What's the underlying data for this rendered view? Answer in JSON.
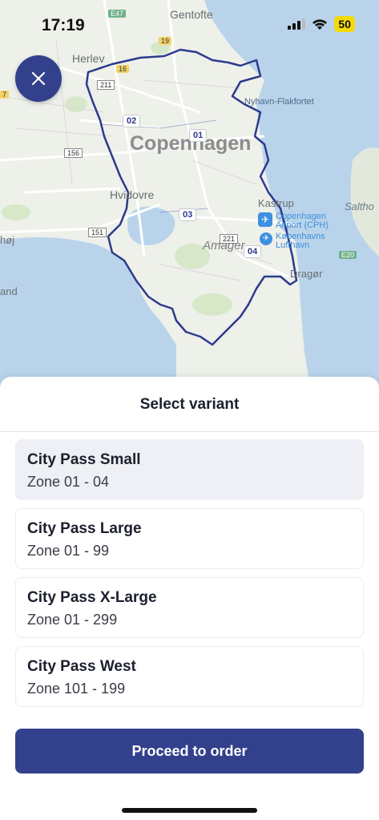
{
  "status_bar": {
    "time": "17:19",
    "battery": "50",
    "icons": [
      "cellular-icon",
      "wifi-icon",
      "battery-icon"
    ]
  },
  "map": {
    "city_label": "Copenhagen",
    "place_labels": {
      "gentofte": "Gentofte",
      "herlev": "Herlev",
      "hvidovre": "Hvidovre",
      "kastrup": "Kastrup",
      "amager": "Amager",
      "dragor": "Dragør",
      "nyhavn": "Nyhavn-Flakfortet",
      "saltholm": "Saltho",
      "hoj": "høj",
      "land": "and"
    },
    "airport_label_1": "Copenhagen",
    "airport_label_2": "Airport (CPH)",
    "airport2_label_1": "Københavns",
    "airport2_label_2": "Lufthavn",
    "zones": [
      "01",
      "02",
      "03",
      "04"
    ],
    "road_badges": [
      "E47",
      "19",
      "16",
      "211",
      "156",
      "151",
      "221",
      "E20",
      "7"
    ],
    "colors": {
      "land": "#eef0ea",
      "water": "#b9d4ea",
      "zone_border": "#2d3a8c",
      "park": "#d7e8c9"
    }
  },
  "close_button": {
    "icon": "close-icon"
  },
  "sheet": {
    "title": "Select variant",
    "variants": [
      {
        "name": "City Pass Small",
        "zone": "Zone 01 - 04",
        "selected": true
      },
      {
        "name": "City Pass Large",
        "zone": "Zone 01 - 99",
        "selected": false
      },
      {
        "name": "City Pass X-Large",
        "zone": "Zone 01 - 299",
        "selected": false
      },
      {
        "name": "City Pass West",
        "zone": "Zone 101 - 199",
        "selected": false
      }
    ],
    "proceed_label": "Proceed to order"
  },
  "colors": {
    "primary": "#33418c",
    "selected_bg": "#eff0f5"
  }
}
